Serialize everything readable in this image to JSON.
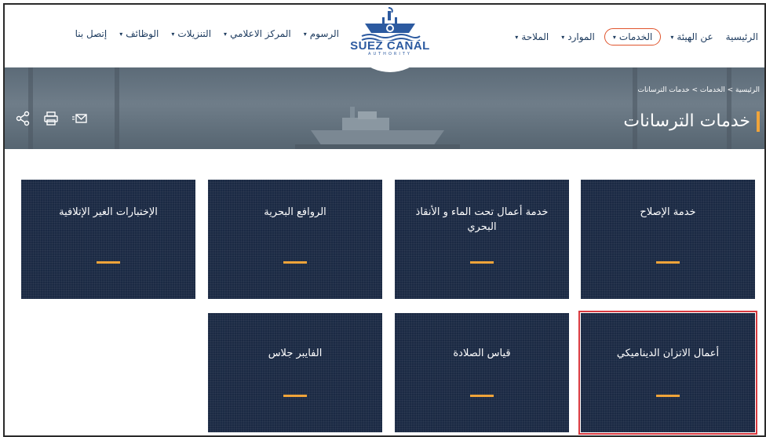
{
  "nav": {
    "right_items": [
      {
        "label": "الرئيسية",
        "caret": false,
        "active": false
      },
      {
        "label": "عن الهيئة",
        "caret": true,
        "active": false
      },
      {
        "label": "الخدمات",
        "caret": true,
        "active": true
      },
      {
        "label": "الموارد",
        "caret": true,
        "active": false
      },
      {
        "label": "الملاحة",
        "caret": true,
        "active": false
      }
    ],
    "left_items": [
      {
        "label": "الرسوم",
        "caret": true
      },
      {
        "label": "المركز الاعلامي",
        "caret": true
      },
      {
        "label": "التنزيلات",
        "caret": true
      },
      {
        "label": "الوظائف",
        "caret": true
      },
      {
        "label": "إتصل بنا",
        "caret": false
      }
    ]
  },
  "logo": {
    "title": "SUEZ CANAL",
    "subtitle": "AUTHORITY"
  },
  "banner": {
    "breadcrumb": "الرئيسية > الخدمات > خدمات الترسانات",
    "title": "خدمات الترسانات",
    "tools": [
      "share-icon",
      "print-icon",
      "email-icon"
    ]
  },
  "cards": [
    {
      "title": "خدمة الإصلاح"
    },
    {
      "title": "خدمة أعمال تحت الماء و الأنقاذ البحري"
    },
    {
      "title": "الروافع البحرية"
    },
    {
      "title": "الإختبارات الغير الإتلافية"
    },
    {
      "title": "أعمال الاتزان الديناميكي"
    },
    {
      "title": "قياس الصلادة"
    },
    {
      "title": "الفايبر جلاس"
    }
  ],
  "colors": {
    "navy": "#1b2a44",
    "accent": "#f0a43a",
    "active_outline": "#e0542c",
    "highlight": "#d8393f"
  }
}
